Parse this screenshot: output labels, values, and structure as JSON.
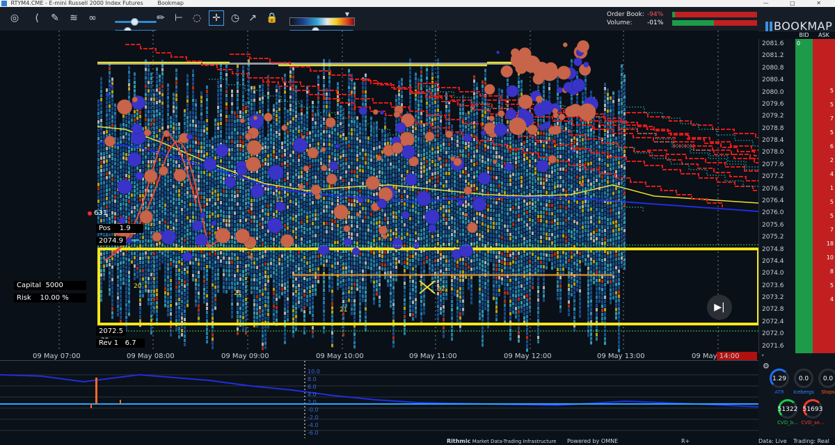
{
  "window": {
    "title": "RTYM4.CME - E-mini Russell 2000 Index Futures",
    "app": "Bookmap"
  },
  "toolbar": {
    "tools": [
      "camera-icon",
      "share-icon",
      "brush-icon",
      "layers-icon",
      "link-icon",
      "pencil-icon",
      "ruler-icon",
      "comment-icon",
      "crosshair-icon",
      "timer-icon",
      "chart-line-icon",
      "lock-icon"
    ]
  },
  "orderbook": {
    "order_book_label": "Order Book:",
    "order_book_value": "-94%",
    "volume_label": "Volume:",
    "volume_value": "-01%"
  },
  "brand": "BOOKMAP",
  "columns": {
    "bid": "BID",
    "ask": "ASK"
  },
  "price_axis": [
    "2081.6",
    "2081.2",
    "2080.8",
    "2080.4",
    "2080.0",
    "2079.6",
    "2079.2",
    "2078.8",
    "2078.4",
    "2078.0",
    "2077.6",
    "2077.2",
    "2076.8",
    "2076.4",
    "2076.0",
    "2075.6",
    "2075.2",
    "2074.8",
    "2074.4",
    "2074.0",
    "2073.6",
    "2073.2",
    "2072.8",
    "2072.4",
    "2072.0",
    "2071.6"
  ],
  "bid_numbers": [
    "0"
  ],
  "ask_numbers": [
    "5",
    "5",
    "7",
    "5",
    "6",
    "2",
    "4",
    "1",
    "5",
    "5",
    "7",
    "18",
    "10",
    "8",
    "5",
    "4"
  ],
  "time_axis": [
    "09 May 07:00",
    "09 May 08:00",
    "09 May 09:00",
    "09 May 10:00",
    "09 May 11:00",
    "09 May 12:00",
    "09 May 13:00",
    "09 May 14:00"
  ],
  "overlay": {
    "dot_value": "631",
    "pos_label": "Pos",
    "pos_value": "1.9",
    "entry_price": "2074.9",
    "capital_label": "Capital",
    "capital_value": "5000",
    "risk_label": "Risk",
    "risk_value": "10.00 %",
    "exit_price": "2072.5",
    "rev_label": "Rev 1",
    "rev_value": "6.7"
  },
  "chart_labels": [
    "20",
    "29",
    "21",
    "62",
    "11",
    "21"
  ],
  "indicator_scale": [
    "10.0",
    "8.0",
    "6.0",
    "4.0",
    "2.0",
    "-0.0",
    "-2.0",
    "-4.0",
    "-6.0"
  ],
  "gauges": [
    {
      "value": "1.29",
      "label": "ATR",
      "color": "#1f6fff",
      "fill": 0.6
    },
    {
      "value": "0.0",
      "label": "Icebergs",
      "color": "#2a8cff",
      "fill": 0.0
    },
    {
      "value": "0.0",
      "label": "Stops",
      "color": "#ff5a2a",
      "fill": 0.0
    },
    {
      "value": "51322",
      "label": "CVD_b...",
      "color": "#1ec84a",
      "fill": 0.5
    },
    {
      "value": "51693",
      "label": "CVD_se...",
      "color": "#ff3a2a",
      "fill": 0.5
    }
  ],
  "status": {
    "provider": "Rithmic",
    "provider_tagline": "Market Data-Trading Infrastructure",
    "powered": "Powered by OMNE",
    "rplus": "R+",
    "data": "Data: Live",
    "trading": "Trading: Real"
  },
  "colors": {
    "bid": "#1e9b4a",
    "ask": "#c22020",
    "yellow_box": "#f5e61c",
    "accent": "#3ea3ff"
  }
}
